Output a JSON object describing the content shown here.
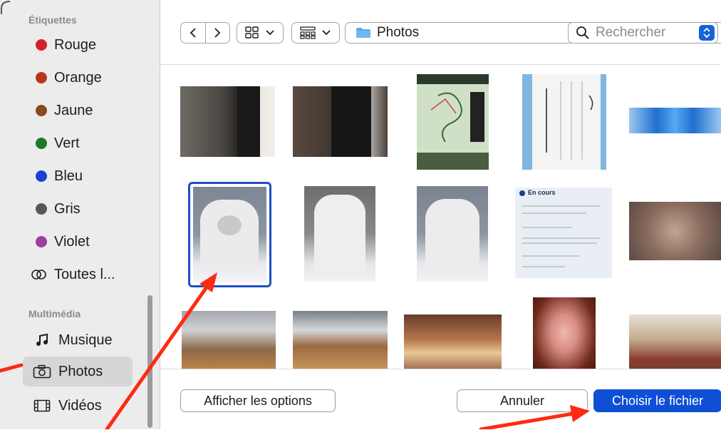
{
  "sidebar": {
    "tags_title": "Étiquettes",
    "tags": [
      {
        "label": "Rouge",
        "color": "#d4202a"
      },
      {
        "label": "Orange",
        "color": "#b9361b"
      },
      {
        "label": "Jaune",
        "color": "#8a4a1c"
      },
      {
        "label": "Vert",
        "color": "#1c7a2c"
      },
      {
        "label": "Bleu",
        "color": "#1c3fd6"
      },
      {
        "label": "Gris",
        "color": "#575757"
      },
      {
        "label": "Violet",
        "color": "#9a3fa6"
      }
    ],
    "all_tags_label": "Toutes l...",
    "media_title": "Multimédia",
    "media": [
      {
        "label": "Musique",
        "icon": "music-note-icon"
      },
      {
        "label": "Photos",
        "icon": "camera-icon",
        "selected": true
      },
      {
        "label": "Vidéos",
        "icon": "film-icon"
      }
    ]
  },
  "toolbar": {
    "back_icon": "chevron-left-icon",
    "forward_icon": "chevron-right-icon",
    "view_icon": "grid-view-icon",
    "group_icon": "group-icon",
    "path_label": "Photos",
    "search_placeholder": "Rechercher"
  },
  "grid": {
    "selected_index": 5,
    "rows": 3,
    "columns": 5
  },
  "footer": {
    "options_label": "Afficher les options",
    "cancel_label": "Annuler",
    "choose_label": "Choisir le fichier"
  },
  "colors": {
    "accent": "#0f4fd6",
    "annotation": "#ff2a12"
  }
}
